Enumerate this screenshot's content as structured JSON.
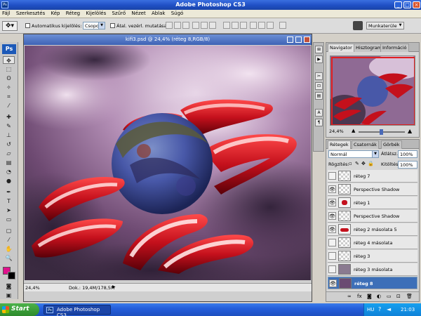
{
  "app": {
    "title": "Adobe Photoshop CS3",
    "logo": "Ps"
  },
  "menu": [
    "Fájl",
    "Szerkesztés",
    "Kép",
    "Réteg",
    "Kijelölés",
    "Szűrő",
    "Nézet",
    "Ablak",
    "Súgó"
  ],
  "options": {
    "auto_select_label": "Automatikus kijelölés:",
    "group_value": "Csoport",
    "transform_label": "Átal. vezérl. mutatása",
    "workspace_label": "Munkaterület"
  },
  "document": {
    "title": "kifi3.psd @ 24,4% (réteg 8,RGB/8)",
    "zoom": "24,4%",
    "doc_size": "Dok.: 19,4M/178,5M"
  },
  "navigator": {
    "tabs": [
      "Navigator",
      "Hisztogram",
      "Információ"
    ],
    "zoom": "24,4%"
  },
  "layers": {
    "tabs": [
      "Rétegek",
      "Csatornák",
      "Görbék"
    ],
    "blend_mode": "Normál",
    "opacity_label": "Átlátsz.:",
    "opacity_value": "100%",
    "lock_label": "Rögzítés:",
    "fill_label": "Kitöltés:",
    "fill_value": "100%",
    "rows": [
      {
        "name": "réteg 7",
        "visible": false,
        "selected": false
      },
      {
        "name": "Perspective Shadow",
        "visible": true,
        "selected": false
      },
      {
        "name": "réteg 1",
        "visible": true,
        "selected": false
      },
      {
        "name": "Perspective Shadow",
        "visible": true,
        "selected": false
      },
      {
        "name": "réteg 2 másolata 5",
        "visible": true,
        "selected": false
      },
      {
        "name": "réteg 4 másolata",
        "visible": false,
        "selected": false
      },
      {
        "name": "réteg 3",
        "visible": false,
        "selected": false
      },
      {
        "name": "réteg 3 másolata",
        "visible": false,
        "selected": false
      },
      {
        "name": "réteg 8",
        "visible": true,
        "selected": true
      }
    ],
    "footer_icons": [
      "link-icon",
      "fx-icon",
      "mask-icon",
      "adjustment-icon",
      "folder-icon",
      "new-layer-icon",
      "trash-icon"
    ]
  },
  "taskbar": {
    "start_label": "Start",
    "task_label": "Adobe Photoshop CS3",
    "lang": "HU",
    "time": "21:03"
  },
  "colors": {
    "foreground": "#e0108c",
    "background": "#000000",
    "accent_red": "#c8102e",
    "xp_blue": "#245edb"
  }
}
